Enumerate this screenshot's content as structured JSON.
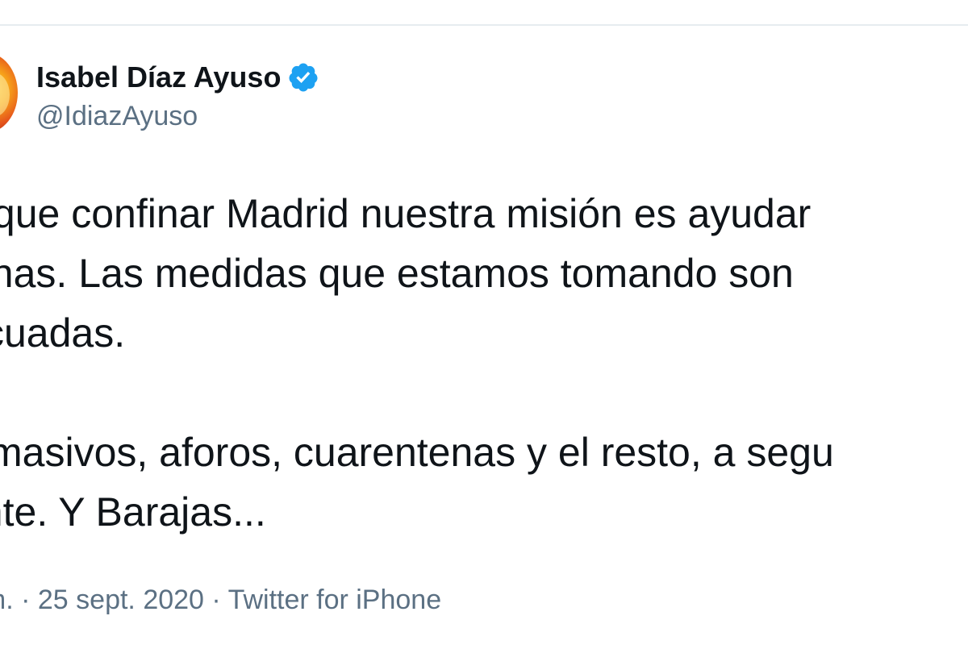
{
  "tweet": {
    "author": {
      "display_name": "Isabel Díaz Ayuso",
      "handle": "@IdiazAyuso",
      "verified_icon": "verified-badge-icon",
      "verified_color": "#1da1f2"
    },
    "text_lines": [
      "s que confinar Madrid nuestra misión es ayudar",
      "sonas. Las medidas que estamos tomando son",
      "cuadas.",
      "masivos, aforos, cuarentenas y el resto, a segu",
      "ante. Y Barajas..."
    ],
    "meta": {
      "time": ". m.",
      "separator_1": " · ",
      "date": "25 sept. 2020",
      "separator_2": " · ",
      "source": "Twitter for iPhone"
    }
  },
  "colors": {
    "text": "#0f1419",
    "secondary": "#5b7083",
    "divider": "#e6ecf0",
    "verified": "#1da1f2"
  }
}
